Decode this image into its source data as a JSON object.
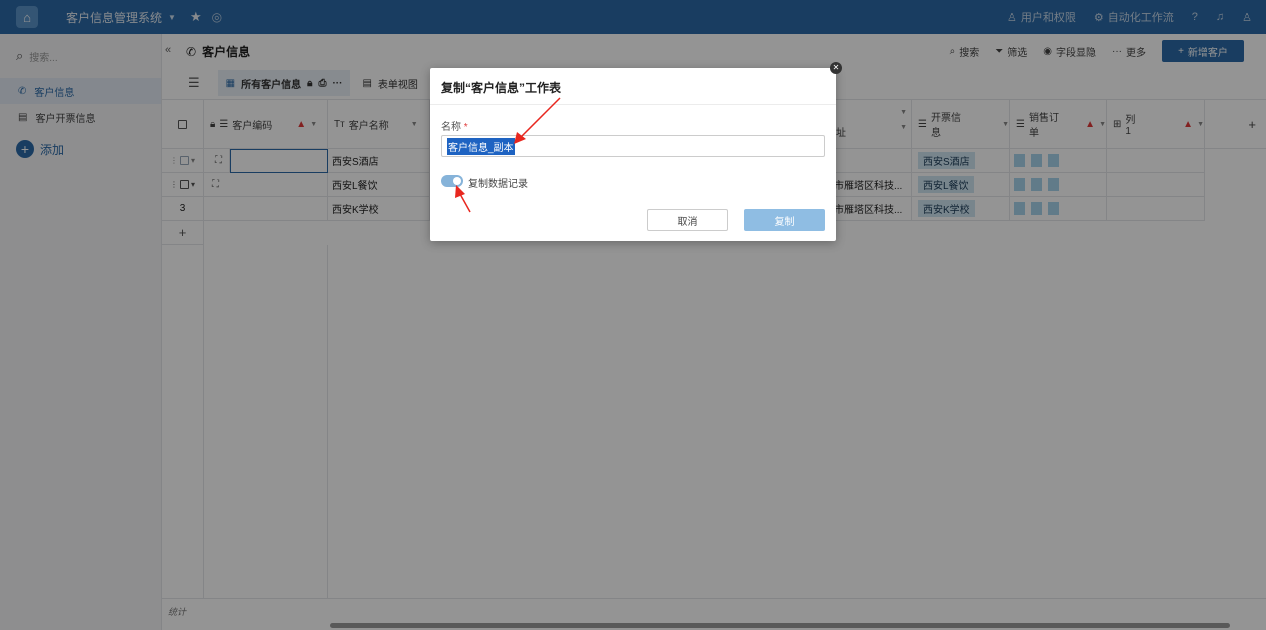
{
  "topbar": {
    "app_title": "客户信息管理系统",
    "links": [
      {
        "icon": "user-permission-icon",
        "label": "用户和权限"
      },
      {
        "icon": "automation-icon",
        "label": "自动化工作流"
      }
    ]
  },
  "sidebar": {
    "search_placeholder": "搜索...",
    "items": [
      {
        "label": "客户信息",
        "icon": "phone-icon",
        "active": true
      },
      {
        "label": "客户开票信息",
        "icon": "document-icon",
        "active": false
      }
    ],
    "add_label": "添加"
  },
  "header": {
    "title": "客户信息",
    "actions": [
      {
        "label": "搜索",
        "icon": "search-icon"
      },
      {
        "label": "筛选",
        "icon": "filter-icon"
      },
      {
        "label": "字段显隐",
        "icon": "eye-icon"
      },
      {
        "label": "更多",
        "icon": "more-icon"
      }
    ],
    "new_button": "新增客户"
  },
  "views": {
    "active": "所有客户信息",
    "second": "表单视图"
  },
  "table": {
    "columns": [
      {
        "label": "客户编码",
        "type_icon": "list-icon",
        "warn": true
      },
      {
        "label": "客户名称",
        "type_icon": "text-icon",
        "prefix": "Tт"
      },
      {
        "label": "址",
        "type_icon": "",
        "warn": false
      },
      {
        "label": "开票信息",
        "type_icon": "list-icon"
      },
      {
        "label": "销售订单",
        "type_icon": "list-icon",
        "warn": true
      },
      {
        "label": "列1",
        "type_icon": "table-icon",
        "warn": true
      }
    ],
    "rows": [
      {
        "num": "",
        "name": "西安S酒店",
        "address": "",
        "invoice": "西安S酒店"
      },
      {
        "num": "",
        "name": "西安L餐饮",
        "address": "市雁塔区科技...",
        "invoice": "西安L餐饮"
      },
      {
        "num": "3",
        "name": "西安K学校",
        "address": "市雁塔区科技...",
        "invoice": "西安K学校"
      }
    ],
    "add_row": "+",
    "stats_label": "统计"
  },
  "dialog": {
    "title": "复制“客户信息”工作表",
    "name_label": "名称",
    "required_mark": "*",
    "name_value": "客户信息_副本",
    "toggle_label": "复制数据记录",
    "toggle_on": true,
    "cancel_label": "取消",
    "copy_label": "复制",
    "accent_color": "#2b6aa7"
  }
}
